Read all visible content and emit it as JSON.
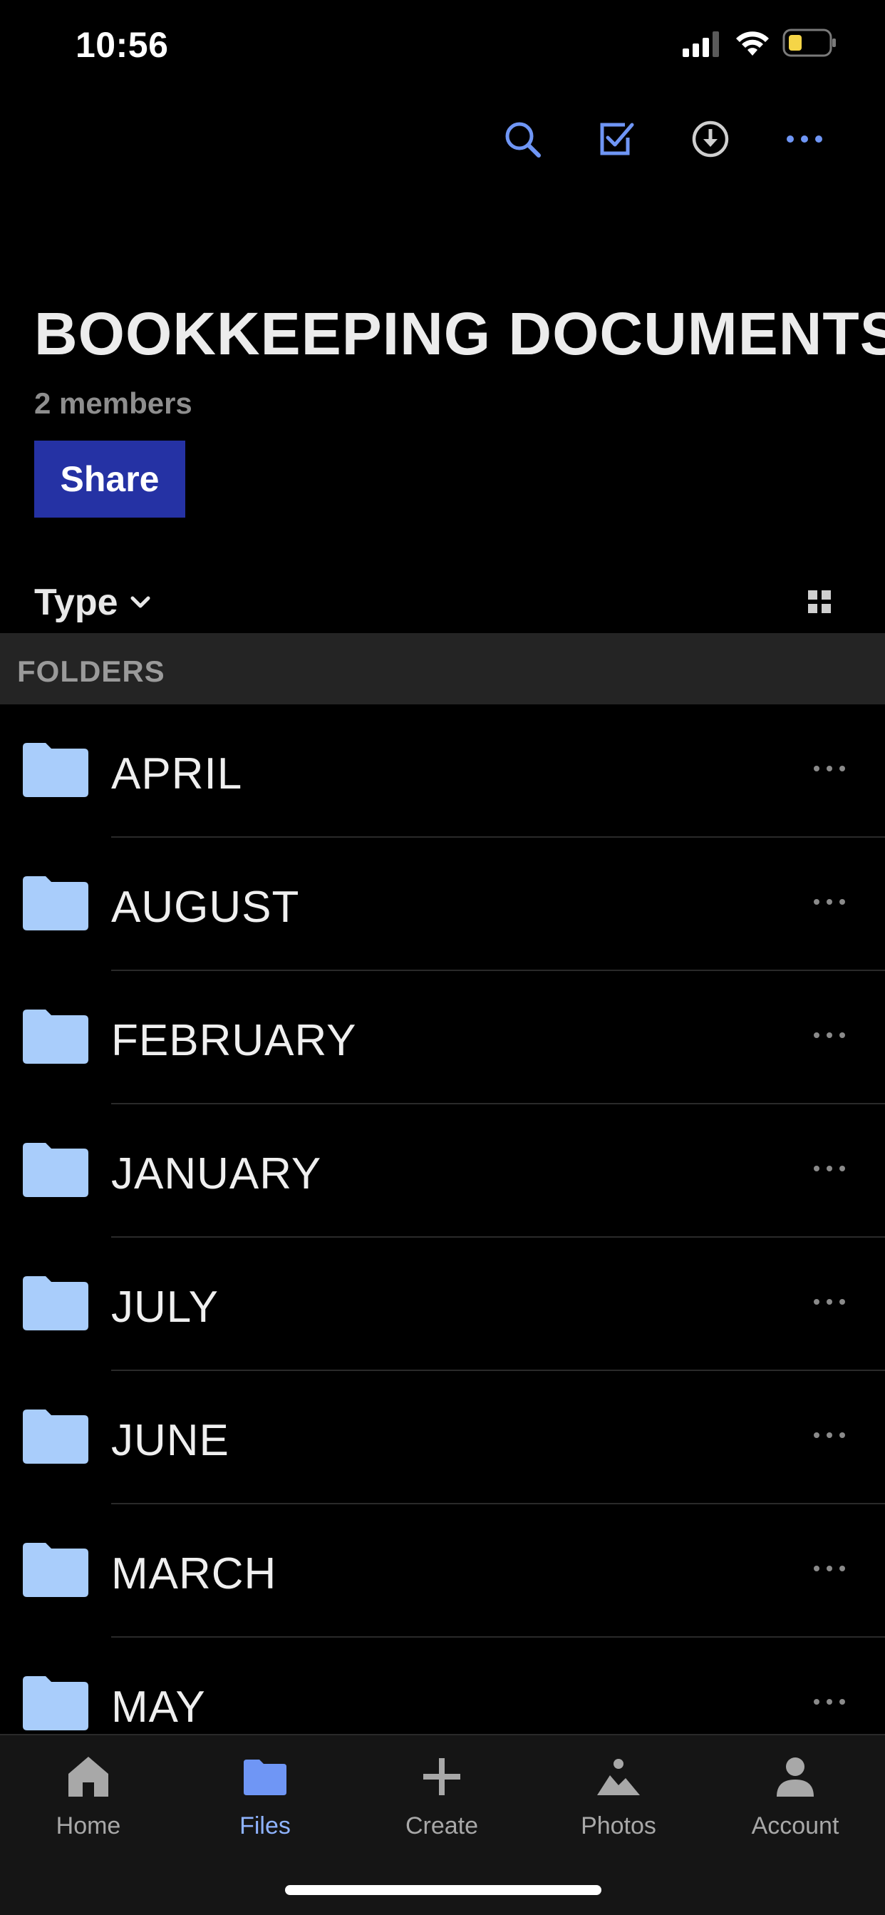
{
  "status_bar": {
    "time": "10:56"
  },
  "header": {
    "title": "BOOKKEEPING DOCUMENTS",
    "members": "2 members",
    "share_label": "Share"
  },
  "sort": {
    "label": "Type"
  },
  "section": {
    "label": "FOLDERS"
  },
  "folders": [
    {
      "name": "APRIL"
    },
    {
      "name": "AUGUST"
    },
    {
      "name": "FEBRUARY"
    },
    {
      "name": "JANUARY"
    },
    {
      "name": "JULY"
    },
    {
      "name": "JUNE"
    },
    {
      "name": "MARCH"
    },
    {
      "name": "MAY"
    }
  ],
  "nav": [
    {
      "label": "Home",
      "icon": "home-icon"
    },
    {
      "label": "Files",
      "icon": "folder-icon",
      "active": true
    },
    {
      "label": "Create",
      "icon": "plus-icon"
    },
    {
      "label": "Photos",
      "icon": "photo-icon"
    },
    {
      "label": "Account",
      "icon": "person-icon"
    }
  ],
  "colors": {
    "accent": "#6f96f5",
    "share_button": "#2532a4",
    "folder": "#a9cdfb",
    "battery": "#f5d547"
  }
}
